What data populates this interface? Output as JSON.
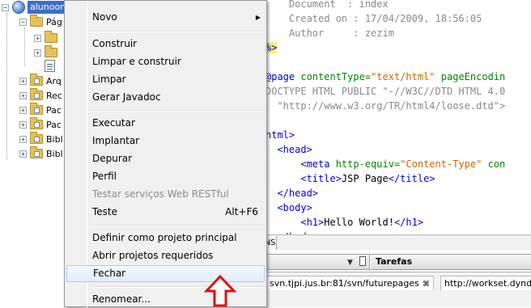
{
  "tree": {
    "project_label": "alunoonline",
    "items": [
      {
        "label": "Pág"
      },
      {
        "label": ""
      },
      {
        "label": ""
      },
      {
        "label": ""
      },
      {
        "label": "Arq"
      },
      {
        "label": "Rec"
      },
      {
        "label": "Pac"
      },
      {
        "label": "Pac"
      },
      {
        "label": "Bibl"
      },
      {
        "label": "Bibl"
      }
    ],
    "header_button": "2"
  },
  "editor": {
    "lines": [
      {
        "segments": [
          [
            "c-comment",
            "    Document  : index"
          ]
        ]
      },
      {
        "segments": [
          [
            "c-comment",
            "    Created on : 17/04/2009, 18:56:05"
          ]
        ]
      },
      {
        "segments": [
          [
            "c-comment",
            "    Author     : zezim"
          ]
        ]
      },
      {
        "segments": [
          [
            "jsp-hl c-kw",
            "%>"
          ]
        ]
      },
      {
        "segments": [
          [
            "c-text",
            ""
          ]
        ]
      },
      {
        "segments": [
          [
            "c-kw",
            "@page "
          ],
          [
            "c-attr",
            "contentType="
          ],
          [
            "c-str",
            "\"text/html\""
          ],
          [
            "c-attr",
            " pageEncodin"
          ]
        ]
      },
      {
        "segments": [
          [
            "c-comment",
            "DOCTYPE HTML PUBLIC \"-//W3C//DTD HTML 4.0"
          ]
        ]
      },
      {
        "segments": [
          [
            "c-comment",
            "  \"http://www.w3.org/TR/html4/loose.dtd\">"
          ]
        ]
      },
      {
        "segments": [
          [
            "c-text",
            ""
          ]
        ]
      },
      {
        "segments": [
          [
            "c-tag",
            "html>"
          ]
        ]
      },
      {
        "segments": [
          [
            "c-tag",
            "  <head>"
          ]
        ]
      },
      {
        "segments": [
          [
            "c-tag",
            "      <meta "
          ],
          [
            "c-attr",
            "http-equiv="
          ],
          [
            "c-str",
            "\"Content-Type\""
          ],
          [
            "c-attr",
            " con"
          ]
        ]
      },
      {
        "segments": [
          [
            "c-tag",
            "      <title>"
          ],
          [
            "c-text",
            "JSP Page"
          ],
          [
            "c-tag",
            "</title>"
          ]
        ]
      },
      {
        "segments": [
          [
            "c-tag",
            "  </head>"
          ]
        ]
      },
      {
        "segments": [
          [
            "c-tag",
            "  <body>"
          ]
        ]
      },
      {
        "segments": [
          [
            "c-tag",
            "      <h1>"
          ],
          [
            "c-text",
            "Hello World!"
          ],
          [
            "c-tag",
            "</h1>"
          ]
        ]
      },
      {
        "segments": [
          [
            "c-tag",
            "  </body>"
          ]
        ]
      }
    ]
  },
  "panels": {
    "nav_tab_label": "NS",
    "tasks_label": "Tarefas",
    "pin_icon": "pin-icon",
    "url_tabs": [
      {
        "label": "svn.tjpi.jus.br:81/svn/futurepages",
        "close": "⌘"
      },
      {
        "label": "http://workset.dyndns",
        "close": ""
      }
    ]
  },
  "menu": {
    "items": [
      {
        "label": "Novo",
        "shortcut": "",
        "submenu": true,
        "disabled": false
      },
      {
        "label": "Construir",
        "shortcut": "",
        "submenu": false,
        "disabled": false
      },
      {
        "label": "Limpar e construir",
        "shortcut": "",
        "submenu": false,
        "disabled": false
      },
      {
        "label": "Limpar",
        "shortcut": "",
        "submenu": false,
        "disabled": false
      },
      {
        "label": "Gerar Javadoc",
        "shortcut": "",
        "submenu": false,
        "disabled": false
      },
      {
        "label": "Executar",
        "shortcut": "",
        "submenu": false,
        "disabled": false
      },
      {
        "label": "Implantar",
        "shortcut": "",
        "submenu": false,
        "disabled": false
      },
      {
        "label": "Depurar",
        "shortcut": "",
        "submenu": false,
        "disabled": false
      },
      {
        "label": "Perfil",
        "shortcut": "",
        "submenu": false,
        "disabled": false
      },
      {
        "label": "Testar serviços Web RESTful",
        "shortcut": "",
        "submenu": false,
        "disabled": true
      },
      {
        "label": "Teste",
        "shortcut": "Alt+F6",
        "submenu": false,
        "disabled": false
      },
      {
        "label": "Definir como projeto principal",
        "shortcut": "",
        "submenu": false,
        "disabled": false
      },
      {
        "label": "Abrir projetos requeridos",
        "shortcut": "",
        "submenu": false,
        "disabled": false
      },
      {
        "label": "Fechar",
        "shortcut": "",
        "submenu": false,
        "disabled": false,
        "highlighted": true
      },
      {
        "label": "Renomear...",
        "shortcut": "",
        "submenu": false,
        "disabled": false
      }
    ]
  },
  "colors": {
    "selection": "#3d6ec9",
    "menu_bg": "#f0f0f0",
    "annotation_arrow": "#e01010"
  }
}
